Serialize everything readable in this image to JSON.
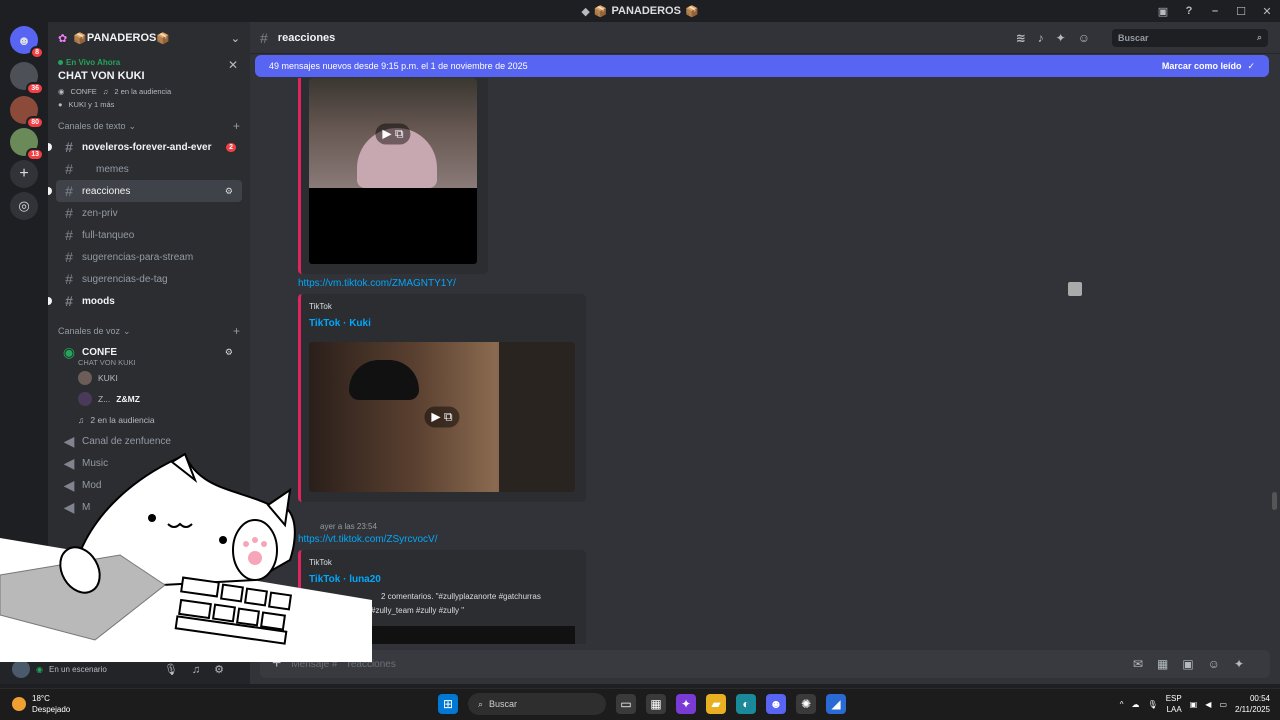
{
  "window": {
    "title": "PANADEROS",
    "title_prefix_emoji": "📦",
    "title_suffix_emoji": "📦"
  },
  "servers": {
    "items": [
      {
        "name": "home",
        "badge": "8"
      },
      {
        "name": "server-1",
        "badge": "36"
      },
      {
        "name": "server-2",
        "badge": "80"
      },
      {
        "name": "server-3",
        "badge": "13"
      }
    ]
  },
  "guild": {
    "name": "PANADEROS",
    "emoji": "📦"
  },
  "live": {
    "tag": "En Vivo Ahora",
    "name": "CHAT VON KUKI",
    "channel": "CONFE",
    "audience": "2 en la audiencia",
    "speakers": "KUKI y 1 más"
  },
  "text_category": "Canales de texto",
  "text_channels": [
    {
      "name": "noveleros-forever-and-ever",
      "unread": true,
      "badge": "2"
    },
    {
      "name": "memes",
      "unread": false
    },
    {
      "name": "reacciones",
      "unread": false,
      "active": true
    },
    {
      "name": "zen-priv",
      "unread": false
    },
    {
      "name": "full-tanqueo",
      "unread": false
    },
    {
      "name": "sugerencias-para-stream",
      "unread": false
    },
    {
      "name": "sugerencias-de-tag",
      "unread": false
    },
    {
      "name": "moods",
      "unread": true
    }
  ],
  "voice_category": "Canales de voz",
  "voice_channels": [
    {
      "name": "CONFE",
      "sub": "CHAT VON KUKI"
    },
    {
      "name": "Canal de zenfuence"
    },
    {
      "name": "Music"
    },
    {
      "name": "Mod"
    },
    {
      "name": "M"
    }
  ],
  "voice_users": [
    {
      "name": "KUKI"
    },
    {
      "name": "Z...",
      "tag": "Z&MZ"
    },
    {
      "name": "2 en la audiencia"
    }
  ],
  "userbar": {
    "status": "En un escenario"
  },
  "channel_header": {
    "name": "reacciones"
  },
  "search": {
    "placeholder": "Buscar"
  },
  "banner": {
    "text": "49 mensajes nuevos desde 9:15 p.m. el 1 de noviembre de 2025",
    "action": "Marcar como leído"
  },
  "messages": [
    {
      "link": "https://vm.tiktok.com/ZMAGNTY1Y/",
      "provider": "TikTok",
      "title": "TikTok · Kuki"
    },
    {
      "timestamp": "ayer a las 23:54",
      "link": "https://vt.tiktok.com/ZSyrcvocV/",
      "provider": "TikTok",
      "title": "TikTok · luna20",
      "desc_1": "2 comentarios. \"#zullyplazanorte #gatchurras",
      "desc_2": "#zully_team  #zully #zully \""
    }
  ],
  "composer": {
    "placeholder": "Mensaje #",
    "channel": "reacciones"
  },
  "taskbar": {
    "temp": "18°C",
    "weather": "Despejado",
    "search": "Buscar",
    "lang_1": "ESP",
    "lang_2": "LAA",
    "time": "00:54",
    "date": "2/11/2025"
  },
  "colors": {
    "accent": "#5865f2",
    "link": "#00a8fc",
    "badge": "#f23f43",
    "embed_border": "#e0245e",
    "live": "#23a55a"
  }
}
